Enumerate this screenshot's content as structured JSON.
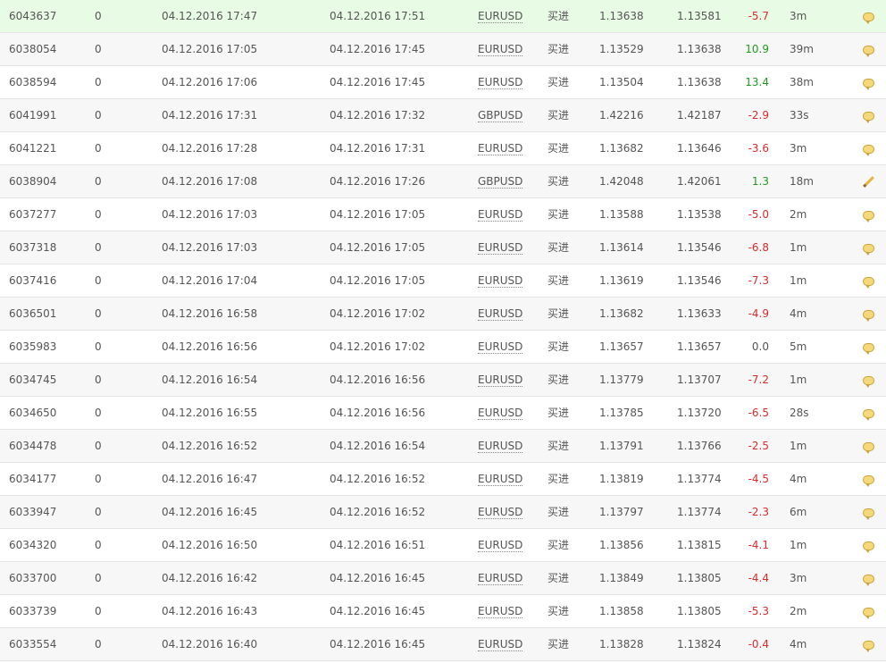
{
  "colors": {
    "positive": "#1f9a1f",
    "negative": "#d62c2c",
    "highlight_row": "#e8fbe4"
  },
  "trades": [
    {
      "id": "6043637",
      "lots": "0",
      "open_time": "04.12.2016 17:47",
      "close_time": "04.12.2016 17:51",
      "symbol": "EURUSD",
      "type": "买进",
      "open_price": "1.13638",
      "close_price": "1.13581",
      "pips": "-5.7",
      "duration": "3m",
      "icon": "comment-icon"
    },
    {
      "id": "6038054",
      "lots": "0",
      "open_time": "04.12.2016 17:05",
      "close_time": "04.12.2016 17:45",
      "symbol": "EURUSD",
      "type": "买进",
      "open_price": "1.13529",
      "close_price": "1.13638",
      "pips": "10.9",
      "duration": "39m",
      "icon": "comment-icon"
    },
    {
      "id": "6038594",
      "lots": "0",
      "open_time": "04.12.2016 17:06",
      "close_time": "04.12.2016 17:45",
      "symbol": "EURUSD",
      "type": "买进",
      "open_price": "1.13504",
      "close_price": "1.13638",
      "pips": "13.4",
      "duration": "38m",
      "icon": "comment-icon"
    },
    {
      "id": "6041991",
      "lots": "0",
      "open_time": "04.12.2016 17:31",
      "close_time": "04.12.2016 17:32",
      "symbol": "GBPUSD",
      "type": "买进",
      "open_price": "1.42216",
      "close_price": "1.42187",
      "pips": "-2.9",
      "duration": "33s",
      "icon": "comment-icon"
    },
    {
      "id": "6041221",
      "lots": "0",
      "open_time": "04.12.2016 17:28",
      "close_time": "04.12.2016 17:31",
      "symbol": "EURUSD",
      "type": "买进",
      "open_price": "1.13682",
      "close_price": "1.13646",
      "pips": "-3.6",
      "duration": "3m",
      "icon": "comment-icon"
    },
    {
      "id": "6038904",
      "lots": "0",
      "open_time": "04.12.2016 17:08",
      "close_time": "04.12.2016 17:26",
      "symbol": "GBPUSD",
      "type": "买进",
      "open_price": "1.42048",
      "close_price": "1.42061",
      "pips": "1.3",
      "duration": "18m",
      "icon": "edit-icon"
    },
    {
      "id": "6037277",
      "lots": "0",
      "open_time": "04.12.2016 17:03",
      "close_time": "04.12.2016 17:05",
      "symbol": "EURUSD",
      "type": "买进",
      "open_price": "1.13588",
      "close_price": "1.13538",
      "pips": "-5.0",
      "duration": "2m",
      "icon": "comment-icon"
    },
    {
      "id": "6037318",
      "lots": "0",
      "open_time": "04.12.2016 17:03",
      "close_time": "04.12.2016 17:05",
      "symbol": "EURUSD",
      "type": "买进",
      "open_price": "1.13614",
      "close_price": "1.13546",
      "pips": "-6.8",
      "duration": "1m",
      "icon": "comment-icon"
    },
    {
      "id": "6037416",
      "lots": "0",
      "open_time": "04.12.2016 17:04",
      "close_time": "04.12.2016 17:05",
      "symbol": "EURUSD",
      "type": "买进",
      "open_price": "1.13619",
      "close_price": "1.13546",
      "pips": "-7.3",
      "duration": "1m",
      "icon": "comment-icon"
    },
    {
      "id": "6036501",
      "lots": "0",
      "open_time": "04.12.2016 16:58",
      "close_time": "04.12.2016 17:02",
      "symbol": "EURUSD",
      "type": "买进",
      "open_price": "1.13682",
      "close_price": "1.13633",
      "pips": "-4.9",
      "duration": "4m",
      "icon": "comment-icon"
    },
    {
      "id": "6035983",
      "lots": "0",
      "open_time": "04.12.2016 16:56",
      "close_time": "04.12.2016 17:02",
      "symbol": "EURUSD",
      "type": "买进",
      "open_price": "1.13657",
      "close_price": "1.13657",
      "pips": "0.0",
      "duration": "5m",
      "icon": "comment-icon"
    },
    {
      "id": "6034745",
      "lots": "0",
      "open_time": "04.12.2016 16:54",
      "close_time": "04.12.2016 16:56",
      "symbol": "EURUSD",
      "type": "买进",
      "open_price": "1.13779",
      "close_price": "1.13707",
      "pips": "-7.2",
      "duration": "1m",
      "icon": "comment-icon"
    },
    {
      "id": "6034650",
      "lots": "0",
      "open_time": "04.12.2016 16:55",
      "close_time": "04.12.2016 16:56",
      "symbol": "EURUSD",
      "type": "买进",
      "open_price": "1.13785",
      "close_price": "1.13720",
      "pips": "-6.5",
      "duration": "28s",
      "icon": "comment-icon"
    },
    {
      "id": "6034478",
      "lots": "0",
      "open_time": "04.12.2016 16:52",
      "close_time": "04.12.2016 16:54",
      "symbol": "EURUSD",
      "type": "买进",
      "open_price": "1.13791",
      "close_price": "1.13766",
      "pips": "-2.5",
      "duration": "1m",
      "icon": "comment-icon"
    },
    {
      "id": "6034177",
      "lots": "0",
      "open_time": "04.12.2016 16:47",
      "close_time": "04.12.2016 16:52",
      "symbol": "EURUSD",
      "type": "买进",
      "open_price": "1.13819",
      "close_price": "1.13774",
      "pips": "-4.5",
      "duration": "4m",
      "icon": "comment-icon"
    },
    {
      "id": "6033947",
      "lots": "0",
      "open_time": "04.12.2016 16:45",
      "close_time": "04.12.2016 16:52",
      "symbol": "EURUSD",
      "type": "买进",
      "open_price": "1.13797",
      "close_price": "1.13774",
      "pips": "-2.3",
      "duration": "6m",
      "icon": "comment-icon"
    },
    {
      "id": "6034320",
      "lots": "0",
      "open_time": "04.12.2016 16:50",
      "close_time": "04.12.2016 16:51",
      "symbol": "EURUSD",
      "type": "买进",
      "open_price": "1.13856",
      "close_price": "1.13815",
      "pips": "-4.1",
      "duration": "1m",
      "icon": "comment-icon"
    },
    {
      "id": "6033700",
      "lots": "0",
      "open_time": "04.12.2016 16:42",
      "close_time": "04.12.2016 16:45",
      "symbol": "EURUSD",
      "type": "买进",
      "open_price": "1.13849",
      "close_price": "1.13805",
      "pips": "-4.4",
      "duration": "3m",
      "icon": "comment-icon"
    },
    {
      "id": "6033739",
      "lots": "0",
      "open_time": "04.12.2016 16:43",
      "close_time": "04.12.2016 16:45",
      "symbol": "EURUSD",
      "type": "买进",
      "open_price": "1.13858",
      "close_price": "1.13805",
      "pips": "-5.3",
      "duration": "2m",
      "icon": "comment-icon"
    },
    {
      "id": "6033554",
      "lots": "0",
      "open_time": "04.12.2016 16:40",
      "close_time": "04.12.2016 16:45",
      "symbol": "EURUSD",
      "type": "买进",
      "open_price": "1.13828",
      "close_price": "1.13824",
      "pips": "-0.4",
      "duration": "4m",
      "icon": "comment-icon"
    }
  ]
}
